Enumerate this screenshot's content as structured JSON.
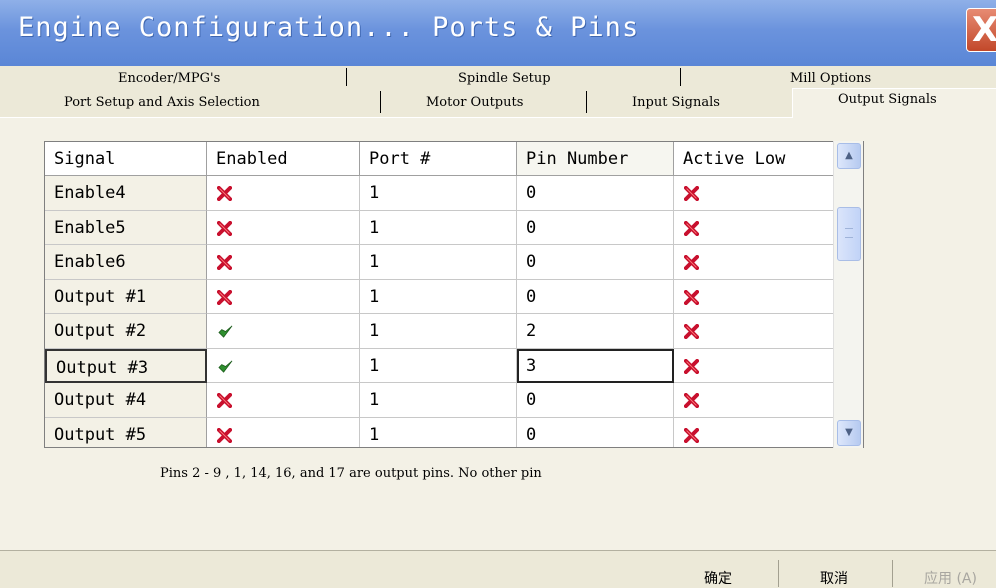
{
  "window": {
    "title": "Engine Configuration... Ports & Pins",
    "close_symbol": "X"
  },
  "tabs_row1": [
    {
      "label": "Encoder/MPG's"
    },
    {
      "label": "Spindle Setup"
    },
    {
      "label": "Mill Options"
    }
  ],
  "tabs_row2": [
    {
      "label": "Port Setup and Axis Selection"
    },
    {
      "label": "Motor Outputs"
    },
    {
      "label": "Input Signals"
    },
    {
      "label": "Output Signals",
      "active": true
    }
  ],
  "table": {
    "columns": [
      "Signal",
      "Enabled",
      "Port #",
      "Pin Number",
      "Active Low"
    ],
    "rows": [
      {
        "signal": "Enable4",
        "enabled": "x-icon",
        "port": "1",
        "pin": "0",
        "active_low": "x-icon"
      },
      {
        "signal": "Enable5",
        "enabled": "x-icon",
        "port": "1",
        "pin": "0",
        "active_low": "x-icon"
      },
      {
        "signal": "Enable6",
        "enabled": "x-icon",
        "port": "1",
        "pin": "0",
        "active_low": "x-icon"
      },
      {
        "signal": "Output #1",
        "enabled": "x-icon",
        "port": "1",
        "pin": "0",
        "active_low": "x-icon"
      },
      {
        "signal": "Output #2",
        "enabled": "check-icon",
        "port": "1",
        "pin": "2",
        "active_low": "x-icon"
      },
      {
        "signal": "Output #3",
        "enabled": "check-icon",
        "port": "1",
        "pin": "3",
        "active_low": "x-icon"
      },
      {
        "signal": "Output #4",
        "enabled": "x-icon",
        "port": "1",
        "pin": "0",
        "active_low": "x-icon"
      },
      {
        "signal": "Output #5",
        "enabled": "x-icon",
        "port": "1",
        "pin": "0",
        "active_low": "x-icon"
      }
    ]
  },
  "note": "Pins 2 - 9 , 1, 14, 16, and 17 are output pins. No  other pin",
  "buttons": {
    "ok": "确定",
    "cancel": "取消",
    "apply": "应用 (A)"
  },
  "colors": {
    "titlebar": "#6b93dd",
    "x_icon": "#c8102e",
    "check_icon": "#2f8f2f",
    "window_bg": "#ece9d8"
  }
}
